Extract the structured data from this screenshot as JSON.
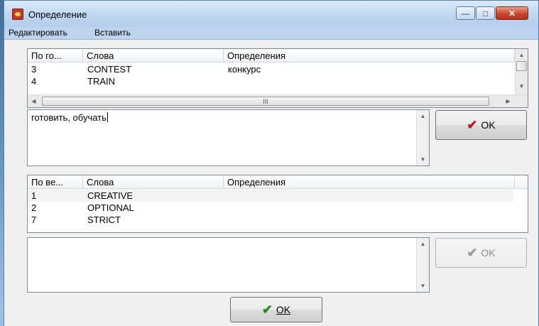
{
  "window": {
    "title": "Определение",
    "controls": {
      "minimize": "—",
      "maximize": "□",
      "close": "✕"
    }
  },
  "menu": {
    "items": [
      "Редактировать",
      "Вставить"
    ]
  },
  "top_list": {
    "columns": [
      "По го...",
      "Слова",
      "Определения"
    ],
    "rows": [
      {
        "num": "3",
        "word": "CONTEST",
        "definition": "конкурс"
      },
      {
        "num": "4",
        "word": "TRAIN",
        "definition": ""
      }
    ],
    "hscroll_thumb": "III"
  },
  "top_editor": {
    "value": "готовить, обучать"
  },
  "top_ok": {
    "label": "OK",
    "enabled": true,
    "icon": "red-check-icon"
  },
  "bottom_list": {
    "columns": [
      "По ве...",
      "Слова",
      "Определения"
    ],
    "rows": [
      {
        "num": "1",
        "word": "CREATIVE",
        "definition": ""
      },
      {
        "num": "2",
        "word": "OPTIONAL",
        "definition": ""
      },
      {
        "num": "7",
        "word": "STRICT",
        "definition": ""
      }
    ]
  },
  "bottom_editor": {
    "value": ""
  },
  "bottom_ok": {
    "label": "OK",
    "enabled": false,
    "icon": "grey-check-icon"
  },
  "main_ok": {
    "label": "OK",
    "icon": "green-check-icon"
  },
  "colors": {
    "accent_check_red": "#c0161d",
    "accent_check_green": "#1e8b1e",
    "close_button": "#c9452c"
  }
}
